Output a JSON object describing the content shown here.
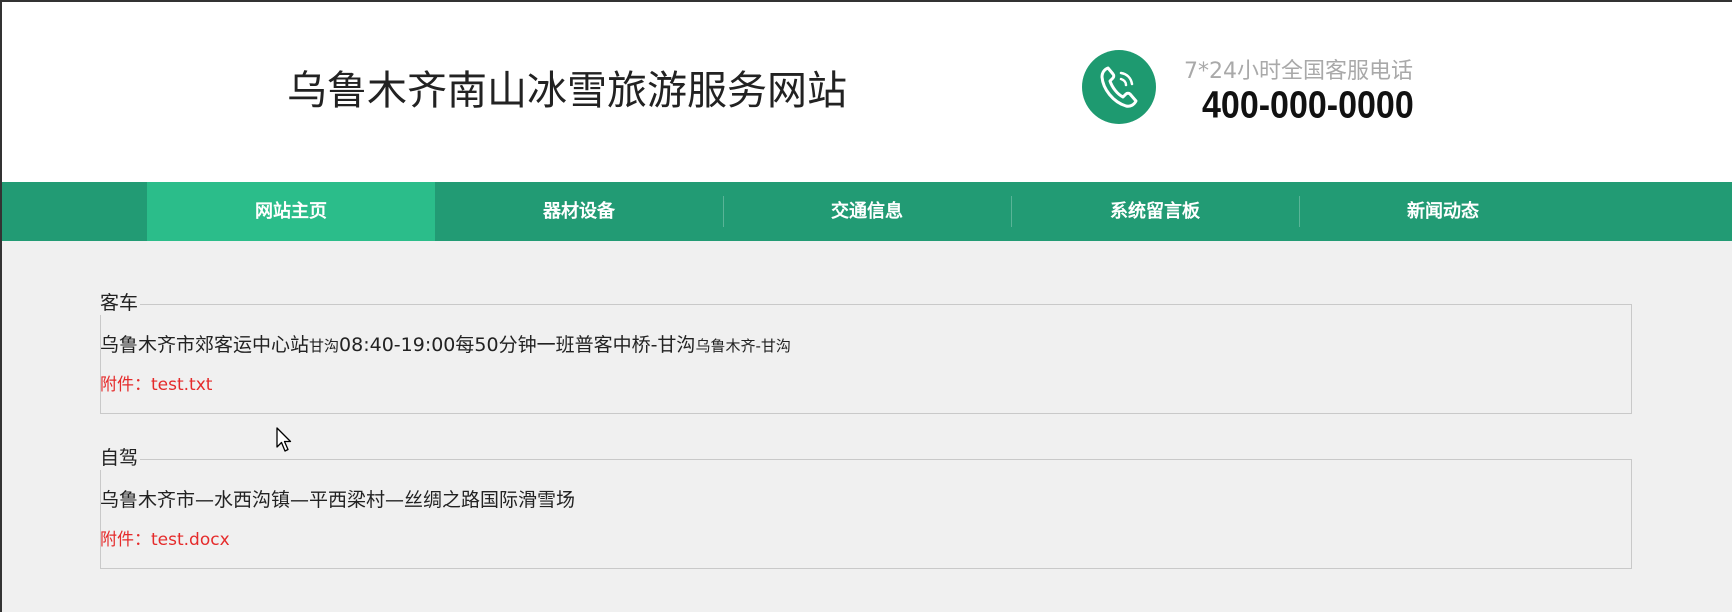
{
  "header": {
    "site_title": "乌鲁木齐南山冰雪旅游服务网站",
    "hotline_label": "7*24小时全国客服电话",
    "hotline_number": "400-000-0000",
    "phone_icon": "phone-icon"
  },
  "nav": {
    "items": [
      {
        "label": "网站主页",
        "active": true
      },
      {
        "label": "器材设备",
        "active": false
      },
      {
        "label": "交通信息",
        "active": false
      },
      {
        "label": "系统留言板",
        "active": false
      },
      {
        "label": "新闻动态",
        "active": false
      }
    ]
  },
  "sections": [
    {
      "title": "客车",
      "desc_main": "乌鲁木齐市郊客运中心站",
      "desc_small1": "甘沟",
      "desc_mid": "08:40-19:00每50分钟一班普客中桥-甘沟",
      "desc_small2": "乌鲁木齐-甘沟",
      "attachment": "附件：test.txt"
    },
    {
      "title": "自驾",
      "desc_main": "乌鲁木齐市—水西沟镇—平西梁村—丝绸之路国际滑雪场",
      "attachment": "附件：test.docx"
    }
  ],
  "colors": {
    "nav_bg": "#229b74",
    "nav_active": "#2bbd8a",
    "attachment": "#e52b2b",
    "phone_circle": "#1e9a70"
  }
}
